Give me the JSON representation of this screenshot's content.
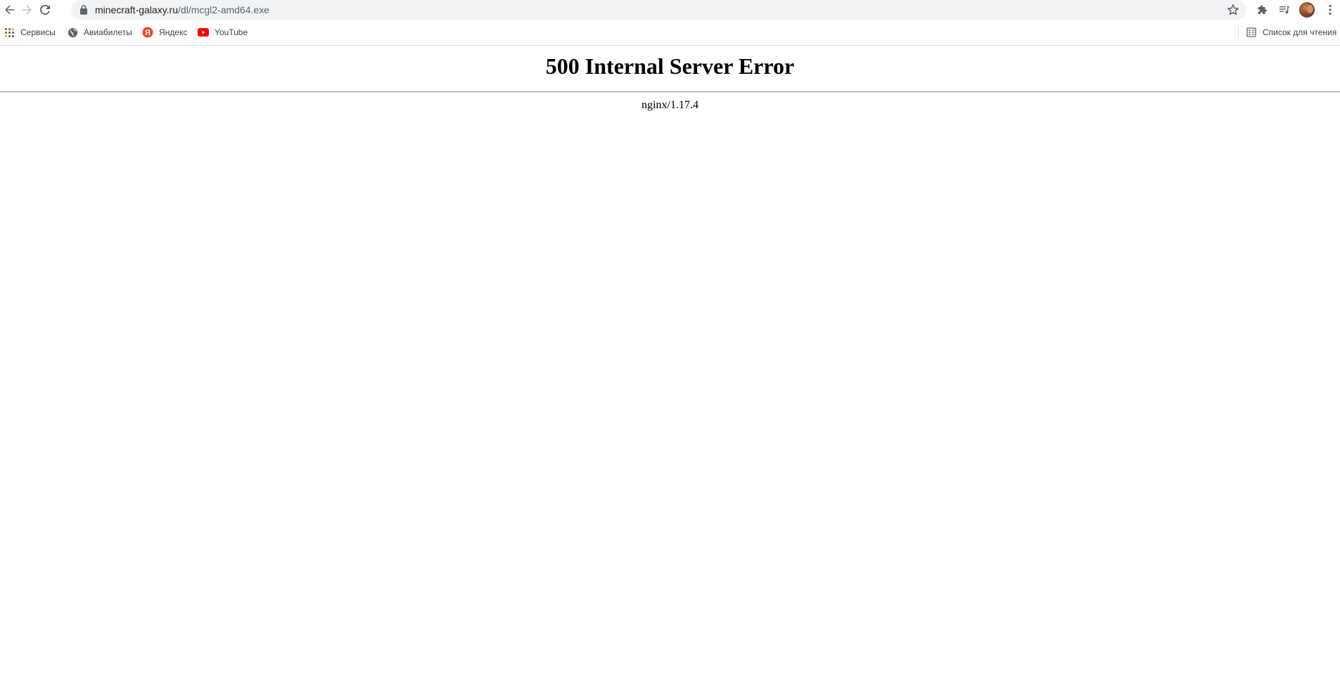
{
  "browser": {
    "url_host": "minecraft-galaxy.ru",
    "url_path": "/dl/mcgl2-amd64.exe",
    "icons": {
      "back": "back-arrow-icon",
      "forward": "forward-arrow-icon",
      "reload": "reload-icon",
      "lock": "lock-icon",
      "bookmark_star": "star-icon",
      "extensions": "puzzle-icon",
      "media": "media-queue-icon",
      "menu": "kebab-menu-icon"
    }
  },
  "bookmarks": {
    "items": [
      {
        "label": "Сервисы",
        "icon": "apps-grid-icon"
      },
      {
        "label": "Авиабилеты",
        "icon": "globe-icon"
      },
      {
        "label": "Яндекс",
        "icon": "yandex-icon"
      },
      {
        "label": "YouTube",
        "icon": "youtube-icon"
      }
    ],
    "reading_list": {
      "label": "Список для чтения",
      "icon": "reading-list-icon"
    }
  },
  "page": {
    "heading": "500 Internal Server Error",
    "server": "nginx/1.17.4"
  },
  "colors": {
    "chrome_bg": "#ffffff",
    "omnibox_bg": "#f1f3f4",
    "icon": "#5f6368",
    "yandex_red": "#fc3f1d",
    "youtube_red": "#ff0000"
  }
}
